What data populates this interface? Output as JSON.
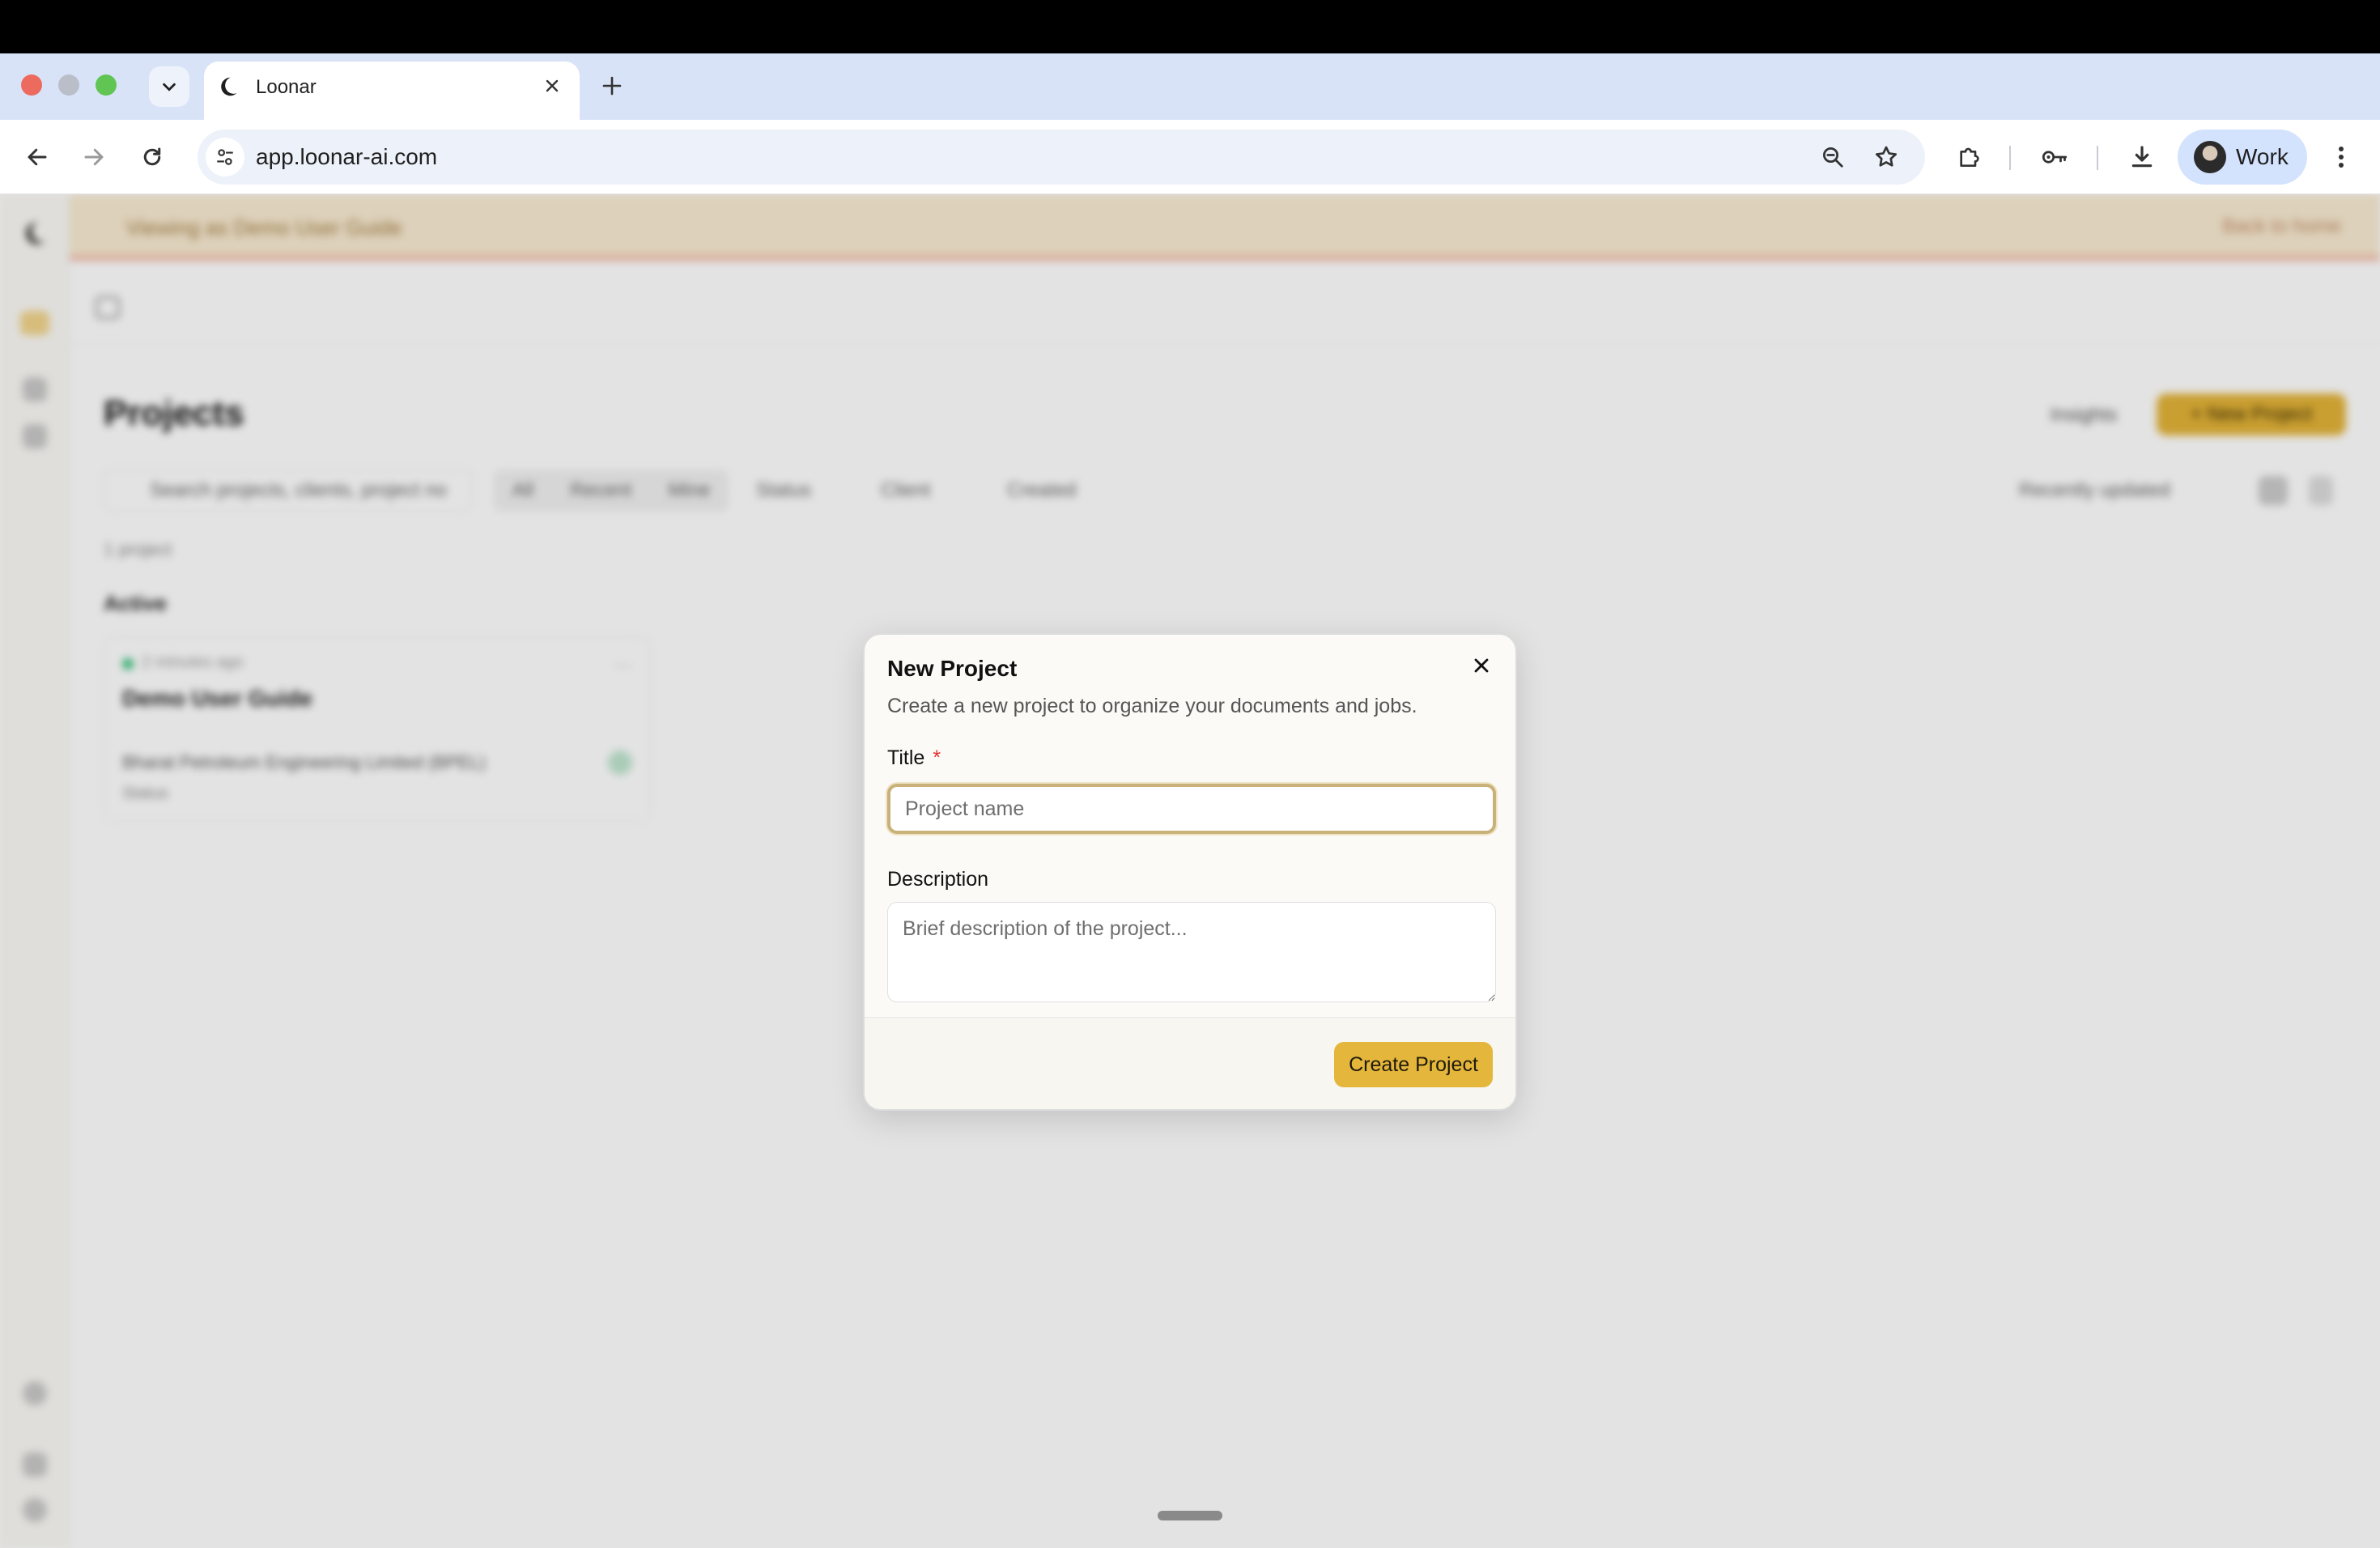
{
  "browser": {
    "tab_title": "Loonar",
    "url": "app.loonar-ai.com",
    "profile_name": "Work"
  },
  "banner": {
    "text": "Viewing as Demo User Guide",
    "back_link": "Back to home"
  },
  "page": {
    "title": "Projects",
    "insights_label": "Insights",
    "new_project_label": "+ New Project",
    "search_placeholder": "Search projects, clients, project no",
    "segments": [
      "All",
      "Recent",
      "Mine"
    ],
    "filters": [
      "Status",
      "Client",
      "Created"
    ],
    "sort_label": "Recently updated",
    "count_label": "1 project",
    "group_label": "Active",
    "project_card": {
      "time": "2 minutes ago",
      "title": "Demo User Guide",
      "client": "Bharat Petroleum Engineering Limited (BPEL)",
      "status": "Status"
    }
  },
  "modal": {
    "title": "New Project",
    "description": "Create a new project to organize your documents and jobs.",
    "title_label": "Title",
    "required_mark": "*",
    "title_placeholder": "Project name",
    "title_value": "",
    "description_label": "Description",
    "description_placeholder": "Brief description of the project...",
    "description_value": "",
    "submit_label": "Create Project"
  },
  "colors": {
    "accent": "#e4b63c",
    "focus_ring": "#c9b27a",
    "required": "#e03131"
  }
}
